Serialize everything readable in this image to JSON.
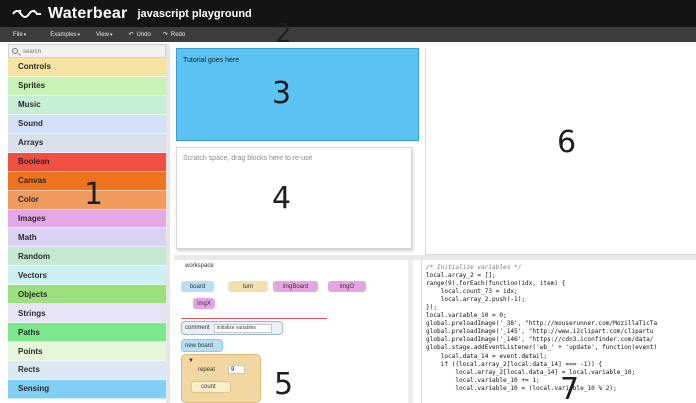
{
  "app": {
    "title": "Waterbear",
    "subtitle": "javascript playground",
    "logo_icon": "waterbear-wave-logo"
  },
  "menubar": {
    "file": "File",
    "examples": "Examples",
    "view": "View",
    "undo": "Undo",
    "redo": "Redo",
    "undo_icon": "undo-arrow-icon",
    "redo_icon": "redo-arrow-icon"
  },
  "search": {
    "placeholder": "search"
  },
  "categories": [
    {
      "label": "Controls",
      "color": "#f6e4a3"
    },
    {
      "label": "Sprites",
      "color": "#c6f2b5"
    },
    {
      "label": "Music",
      "color": "#c6f0d6"
    },
    {
      "label": "Sound",
      "color": "#d4e0f8"
    },
    {
      "label": "Arrays",
      "color": "#d9e0ea"
    },
    {
      "label": "Boolean",
      "color": "#f04f42"
    },
    {
      "label": "Canvas",
      "color": "#ee741f"
    },
    {
      "label": "Color",
      "color": "#f09a5e"
    },
    {
      "label": "Images",
      "color": "#e4a8e6"
    },
    {
      "label": "Math",
      "color": "#dbd3f3"
    },
    {
      "label": "Random",
      "color": "#c5e8d3"
    },
    {
      "label": "Vectors",
      "color": "#cdf0f3"
    },
    {
      "label": "Objects",
      "color": "#9ce07e"
    },
    {
      "label": "Strings",
      "color": "#e8e4f8"
    },
    {
      "label": "Paths",
      "color": "#7ee88e"
    },
    {
      "label": "Points",
      "color": "#e7f7d9"
    },
    {
      "label": "Rects",
      "color": "#dce9f5"
    },
    {
      "label": "Sensing",
      "color": "#7fcff6"
    }
  ],
  "tutorial": {
    "text": "Tutorial goes here",
    "bg": "#5bc4f5"
  },
  "scratch": {
    "text": "Scratch space, drag blocks here to re-use"
  },
  "workspace": {
    "label": "workspace",
    "chips": [
      "board",
      "turn",
      "imgBoard",
      "imgO",
      "imgX"
    ],
    "comment_label": "comment",
    "comment_value": "initialize variables",
    "new_board": "new board",
    "repeat_label": "repeat",
    "repeat_value": "9",
    "repeat_arrow": "▼",
    "count_label": "count"
  },
  "code": {
    "lines": [
      "/* Initialize variables */",
      "local.array_2 = [];",
      "range(9).forEach(function(idx, item) {",
      "    local.count_73 = idx;",
      "    local.array_2.push(-1);",
      "});",
      "local.variable_10 = 0;",
      "global.preloadImage('_38', \"http://mouserunner.com/MozillaTicTa",
      "global.preloadImage('_145', \"http://www.i2clipart.com/clipartu",
      "global.preloadImage('_146', \"https://cdn3.iconfinder.com/data/",
      "global.stage.addEventListener('wb_' + 'update', function(event)",
      "    local.data_14 = event.detail;",
      "    if ((local.array_2[local.data_14] === -1)) {",
      "        local.array_2[local.data_14] = local.variable_10;",
      "        local.variable_10 += 1;",
      "        local.variable_10 = (local.variable_10 % 2);"
    ]
  },
  "region_numbers": [
    "1",
    "2",
    "3",
    "4",
    "5",
    "6",
    "7"
  ]
}
